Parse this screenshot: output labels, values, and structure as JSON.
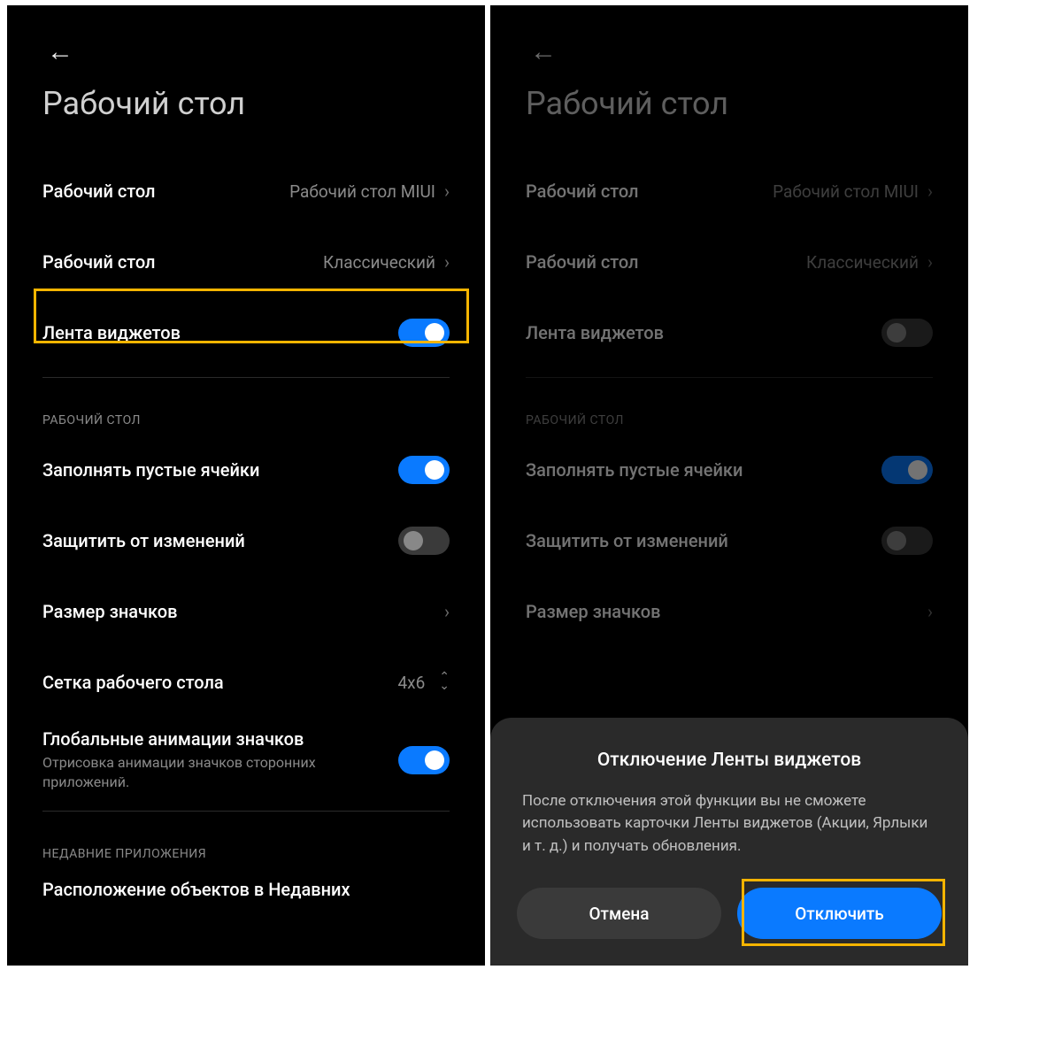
{
  "page_title": "Рабочий стол",
  "left": {
    "rows": {
      "launcher": {
        "label": "Рабочий стол",
        "value": "Рабочий стол MIUI"
      },
      "style": {
        "label": "Рабочий стол",
        "value": "Классический"
      },
      "widget_feed": {
        "label": "Лента виджетов"
      },
      "section1": "РАБОЧИЙ СТОЛ",
      "fill_empty": {
        "label": "Заполнять пустые ячейки"
      },
      "lock": {
        "label": "Защитить от изменений"
      },
      "icon_size": {
        "label": "Размер значков"
      },
      "grid": {
        "label": "Сетка рабочего стола",
        "value": "4x6"
      },
      "anim": {
        "label": "Глобальные анимации значков",
        "sub": "Отрисовка анимации значков сторонних приложений."
      },
      "section2": "НЕДАВНИЕ ПРИЛОЖЕНИЯ",
      "recent_layout": {
        "label": "Расположение объектов в Недавних"
      }
    }
  },
  "right": {
    "rows": {
      "launcher": {
        "label": "Рабочий стол",
        "value": "Рабочий стол MIUI"
      },
      "style": {
        "label": "Рабочий стол",
        "value": "Классический"
      },
      "widget_feed": {
        "label": "Лента виджетов"
      },
      "section1": "РАБОЧИЙ СТОЛ",
      "fill_empty": {
        "label": "Заполнять пустые ячейки"
      },
      "lock": {
        "label": "Защитить от изменений"
      },
      "icon_size": {
        "label": "Размер значков"
      }
    },
    "dialog": {
      "title": "Отключение Ленты виджетов",
      "body": "После отключения этой функции вы не сможете использовать карточки Ленты виджетов (Акции, Ярлыки и т. д.) и получать обновления.",
      "cancel": "Отмена",
      "confirm": "Отключить"
    }
  }
}
